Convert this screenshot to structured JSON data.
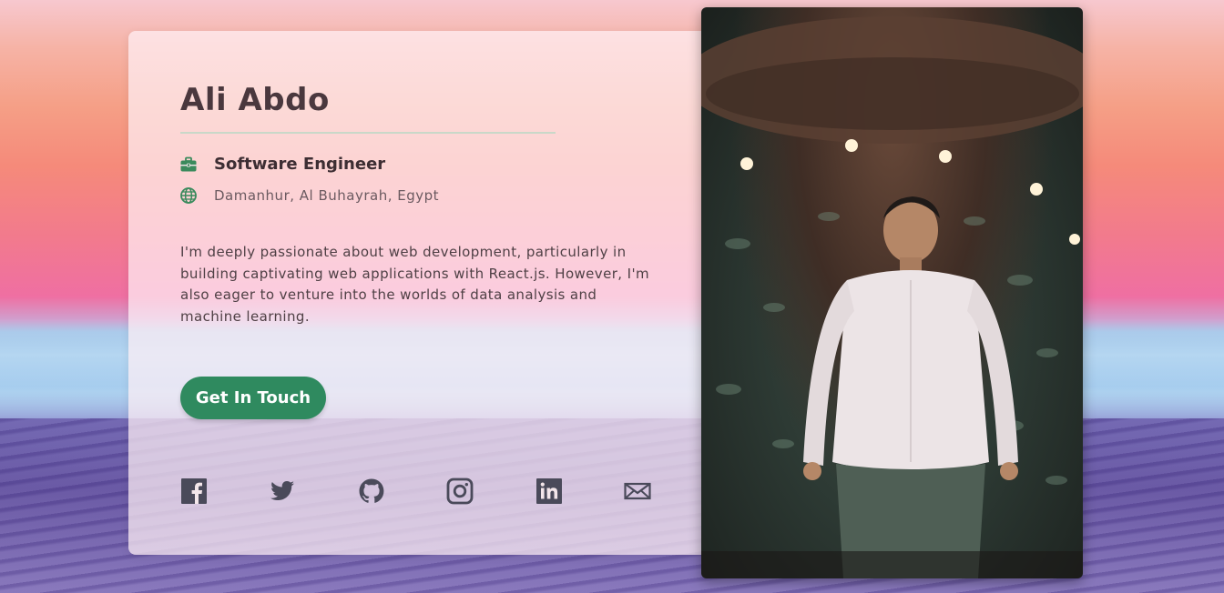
{
  "profile": {
    "name": "Ali Abdo",
    "job_title": "Software Engineer",
    "location": "Damanhur, Al Buhayrah, Egypt",
    "bio": "I'm deeply passionate about web development, particularly in building captivating web applications with React.js. However, I'm also eager to venture into the worlds of data analysis and machine learning.",
    "cta_label": "Get In Touch"
  },
  "icons": {
    "job": "briefcase-icon",
    "location": "globe-icon",
    "social": [
      "facebook-icon",
      "twitter-icon",
      "github-icon",
      "instagram-icon",
      "linkedin-icon",
      "email-icon"
    ]
  },
  "colors": {
    "accent": "#2f8a5f",
    "icon_green": "#3a8a5c",
    "social_icon": "#4a4a5a",
    "name_text": "#4a383e"
  }
}
